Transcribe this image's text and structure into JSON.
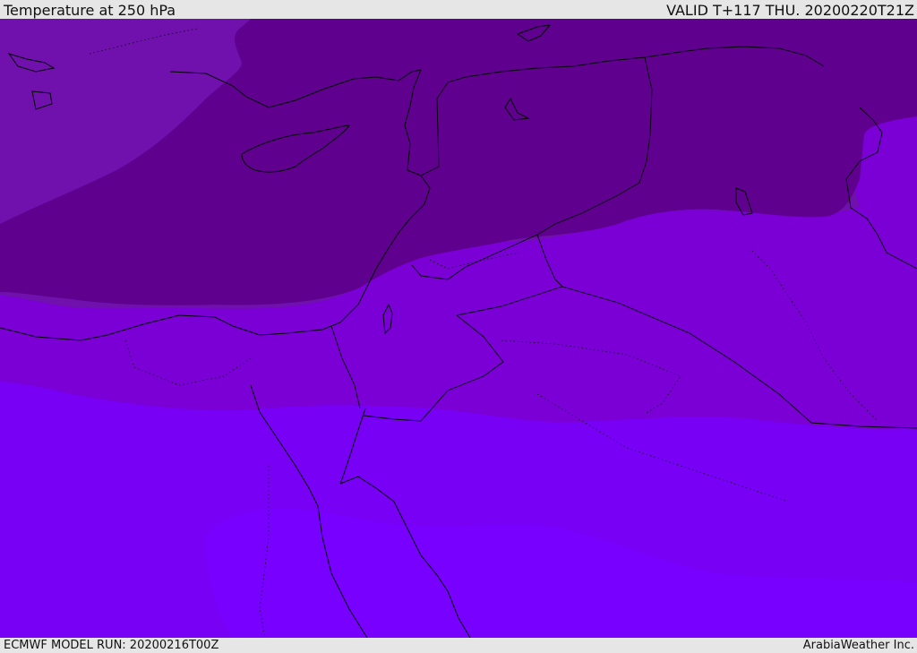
{
  "header": {
    "title": "Temperature at 250 hPa",
    "valid_time": "VALID T+117 THU. 20200220T21Z"
  },
  "footer": {
    "model_run": "ECMWF MODEL RUN: 20200216T00Z",
    "credit": "ArabiaWeather Inc."
  },
  "map": {
    "band_colors": [
      "#5f008f",
      "#7010ad",
      "#7a00d6",
      "#7700f5",
      "#7700ff"
    ],
    "coastline_color": "#000000",
    "border_color": "#000000"
  }
}
